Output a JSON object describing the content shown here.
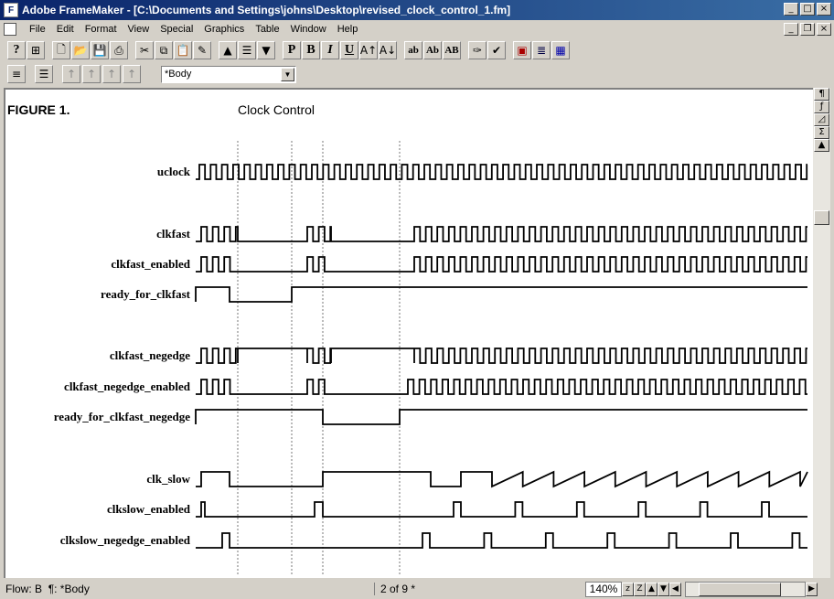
{
  "window": {
    "title": "Adobe FrameMaker - [C:\\Documents and Settings\\johns\\Desktop\\revised_clock_control_1.fm]",
    "app_icon_glyph": "F"
  },
  "menu": {
    "items": [
      {
        "label": "File",
        "key": "F"
      },
      {
        "label": "Edit",
        "key": "E"
      },
      {
        "label": "Format",
        "key": "o"
      },
      {
        "label": "View",
        "key": "V"
      },
      {
        "label": "Special",
        "key": "S"
      },
      {
        "label": "Graphics",
        "key": "G"
      },
      {
        "label": "Table",
        "key": "T"
      },
      {
        "label": "Window",
        "key": "W"
      },
      {
        "label": "Help",
        "key": "H"
      }
    ]
  },
  "toolbar": {
    "text_buttons": [
      "P",
      "B",
      "I",
      "U",
      "ab",
      "Ab",
      "AB"
    ],
    "paragraph_tag": "*Body"
  },
  "document": {
    "figure_label": "FIGURE 1.",
    "figure_title": "Clock Control",
    "signals": [
      "uclock",
      "clkfast",
      "clkfast_enabled",
      "ready_for_clkfast",
      "clkfast_negedge",
      "clkfast_negedge_enabled",
      "ready_for_clkfast_negedge",
      "clk_slow",
      "clkslow_enabled",
      "clkslow_negedge_enabled"
    ]
  },
  "status": {
    "flow": "Flow: B",
    "para": "¶: *Body",
    "page": "2 of 9 *",
    "zoom": "140%"
  },
  "colors": {
    "title_start": "#0a246a",
    "title_end": "#3a6ea5",
    "chrome": "#d4d0c8"
  },
  "icons": [
    "help-icon",
    "new-doc-icon",
    "open-folder-icon",
    "save-icon",
    "cut-icon",
    "copy-icon",
    "paste-icon",
    "format-painter-icon",
    "arrow-up-icon",
    "spell-check-icon",
    "table-icon"
  ]
}
